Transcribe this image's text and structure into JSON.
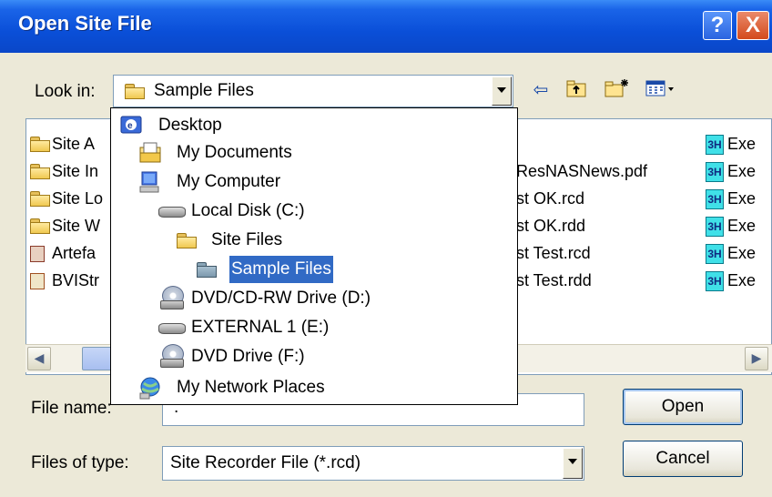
{
  "window": {
    "title": "Open Site File"
  },
  "titlebar_buttons": {
    "help": "?",
    "close": "X"
  },
  "look_in": {
    "label": "Look in:",
    "value": "Sample Files"
  },
  "file_list": {
    "left_items": [
      "Site A",
      "Site In",
      "Site Lo",
      "Site W",
      "Artefa",
      "BVIStr"
    ],
    "middle_items": [
      "ResNASNews.pdf",
      "st OK.rcd",
      "st OK.rdd",
      "st Test.rcd",
      "st Test.rdd"
    ],
    "right_items": [
      "Exe",
      "Exe",
      "Exe",
      "Exe",
      "Exe",
      "Exe"
    ],
    "right_badge": "3H"
  },
  "dropdown_items": [
    {
      "label": "Desktop",
      "icon": "desktop-icon"
    },
    {
      "label": "My Documents",
      "icon": "my-documents-icon"
    },
    {
      "label": "My Computer",
      "icon": "my-computer-icon"
    },
    {
      "label": "Local Disk (C:)",
      "icon": "hard-drive-icon"
    },
    {
      "label": "Site Files",
      "icon": "folder-icon"
    },
    {
      "label": "Sample Files",
      "icon": "folder-open-icon"
    },
    {
      "label": "DVD/CD-RW Drive (D:)",
      "icon": "cd-drive-icon"
    },
    {
      "label": "EXTERNAL 1 (E:)",
      "icon": "hard-drive-icon"
    },
    {
      "label": "DVD Drive (F:)",
      "icon": "cd-drive-icon"
    },
    {
      "label": "My Network Places",
      "icon": "network-places-icon"
    }
  ],
  "file_name": {
    "label": "File name:",
    "value": "."
  },
  "file_type": {
    "label": "Files of type:",
    "value": "Site Recorder File (*.rcd)"
  },
  "buttons": {
    "open": "Open",
    "cancel": "Cancel"
  },
  "colors": {
    "titlebar": "#0a4fd8",
    "selection": "#316ac5",
    "dialog_bg": "#ece9d8"
  }
}
